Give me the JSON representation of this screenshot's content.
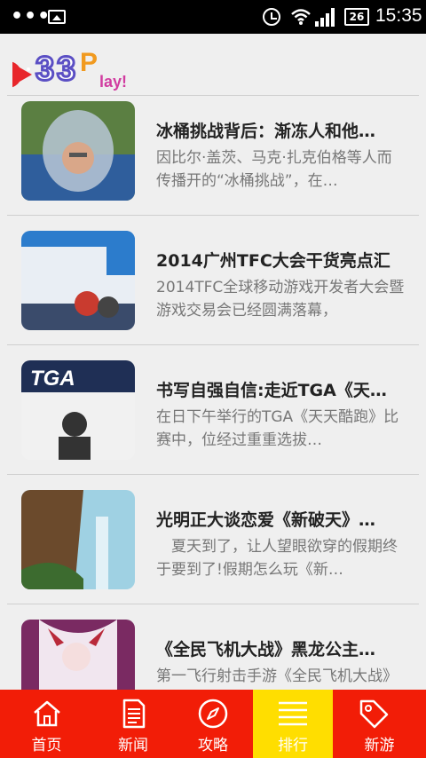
{
  "status_bar": {
    "time": "15:35",
    "battery": "26",
    "icons": [
      "more-dots-icon",
      "gallery-icon",
      "alarm-icon",
      "wifi-icon",
      "signal-icon",
      "battery-icon"
    ]
  },
  "header": {
    "logo_text": "33Play!"
  },
  "articles": [
    {
      "title": "冰桶挑战背后：渐冻人和他…",
      "desc": "因比尔·盖茨、马克·扎克伯格等人而传播开的“冰桶挑战”，在…",
      "thumb_colors": [
        "#5b7f42",
        "#b8c7d6",
        "#2f5e9c"
      ]
    },
    {
      "title": "2014广州TFC大会干货亮点汇",
      "desc": "2014TFC全球移动游戏开发者大会暨游戏交易会已经圆满落幕，",
      "thumb_colors": [
        "#2c7ccc",
        "#e9eef4",
        "#c93b2f"
      ]
    },
    {
      "title": "书写自强自信:走近TGA《天…",
      "desc": "在日下午举行的TGA《天天酷跑》比赛中，位经过重重选拔…",
      "thumb_colors": [
        "#1f2f55",
        "#f1f1f1",
        "#333333"
      ]
    },
    {
      "title": "光明正大谈恋爱《新破天》…",
      "desc": "　夏天到了，让人望眼欲穿的假期终于要到了!假期怎么玩《新…",
      "thumb_colors": [
        "#6b4a2c",
        "#9fd1e3",
        "#3c6b2f"
      ]
    },
    {
      "title": "《全民飞机大战》黑龙公主…",
      "desc": "第一飞行射击手游《全民飞机大战》再上新星强势来袭，接档…",
      "thumb_colors": [
        "#7a2a62",
        "#f1e6ef",
        "#b92a3a"
      ]
    }
  ],
  "bottom_nav": {
    "tabs": [
      {
        "label": "首页",
        "icon": "home-icon"
      },
      {
        "label": "新闻",
        "icon": "news-icon"
      },
      {
        "label": "攻略",
        "icon": "compass-icon"
      },
      {
        "label": "排行",
        "icon": "menu-list-icon",
        "active": true
      },
      {
        "label": "新游",
        "icon": "tag-icon"
      }
    ],
    "bg_color": "#f21d07",
    "active_color": "#ffde00"
  }
}
